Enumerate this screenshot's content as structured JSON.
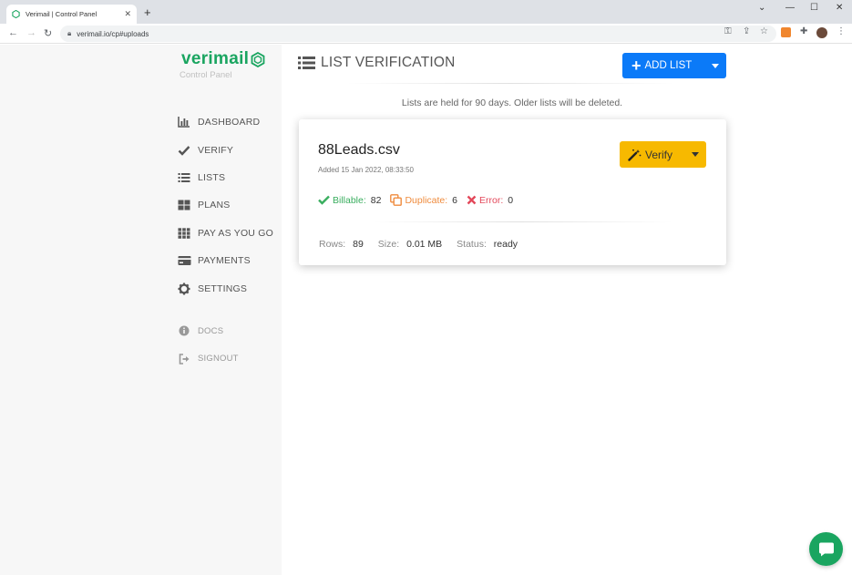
{
  "browser": {
    "tab_title": "Verimail | Control Panel",
    "url": "verimail.io/cp#uploads"
  },
  "brand": {
    "name": "verimail",
    "subtitle": "Control Panel",
    "color": "#1aa560"
  },
  "sidebar": {
    "items": [
      {
        "label": "DASHBOARD",
        "icon": "bar-chart-icon"
      },
      {
        "label": "VERIFY",
        "icon": "check-icon"
      },
      {
        "label": "LISTS",
        "icon": "list-icon"
      },
      {
        "label": "PLANS",
        "icon": "grid-icon"
      },
      {
        "label": "PAY AS YOU GO",
        "icon": "apps-grid-icon"
      },
      {
        "label": "PAYMENTS",
        "icon": "credit-card-icon"
      },
      {
        "label": "SETTINGS",
        "icon": "gear-icon"
      }
    ],
    "secondary": [
      {
        "label": "DOCS",
        "icon": "info-icon"
      },
      {
        "label": "SIGNOUT",
        "icon": "sign-out-icon"
      }
    ]
  },
  "main": {
    "title": "LIST VERIFICATION",
    "add_list_label": "ADD LIST",
    "notice": "Lists are held for 90 days. Older lists will be deleted.",
    "card": {
      "filename": "88Leads.csv",
      "added": "Added 15 Jan 2022, 08:33:50",
      "verify_label": "Verify",
      "billable_label": "Billable:",
      "billable_value": "82",
      "duplicate_label": "Duplicate:",
      "duplicate_value": "6",
      "error_label": "Error:",
      "error_value": "0",
      "rows_label": "Rows:",
      "rows_value": "89",
      "size_label": "Size:",
      "size_value": "0.01 MB",
      "status_label": "Status:",
      "status_value": "ready"
    }
  },
  "colors": {
    "primary_button": "#0b7af8",
    "verify_button": "#f7b900",
    "billable": "#3aae5f",
    "duplicate": "#ef8b3d",
    "error": "#e3485a"
  }
}
